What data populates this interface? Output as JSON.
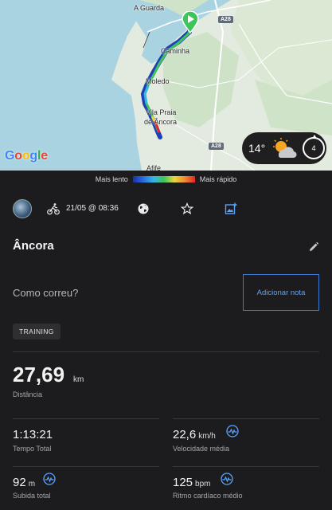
{
  "map": {
    "places": [
      "A Guarda",
      "Caminha",
      "Moledo",
      "Vila Praia",
      "de Âncora",
      "Afife"
    ],
    "roads": [
      "A28",
      "A28"
    ],
    "provider": "Google"
  },
  "weather": {
    "temperature": "14°",
    "wind": "4"
  },
  "speed_legend": {
    "slow": "Mais lento",
    "fast": "Mais rápido"
  },
  "activity": {
    "datetime": "21/05 @ 08:36",
    "title": "Âncora",
    "how_prompt": "Como correu?",
    "add_note": "Adicionar nota",
    "tag": "TRAINING"
  },
  "stats": {
    "distance": {
      "value": "27,69",
      "unit": "km",
      "label": "Distância"
    },
    "total_time": {
      "value": "1:13:21",
      "label": "Tempo Total"
    },
    "avg_speed": {
      "value": "22,6",
      "unit": "km/h",
      "label": "Velocidade média"
    },
    "ascent": {
      "value": "92",
      "unit": "m",
      "label": "Subida total"
    },
    "heart_rate": {
      "value": "125",
      "unit": "bpm",
      "label": "Ritmo cardíaco médio"
    }
  },
  "colors": {
    "accent": "#3a7bd5",
    "background": "#1c1c1e"
  }
}
